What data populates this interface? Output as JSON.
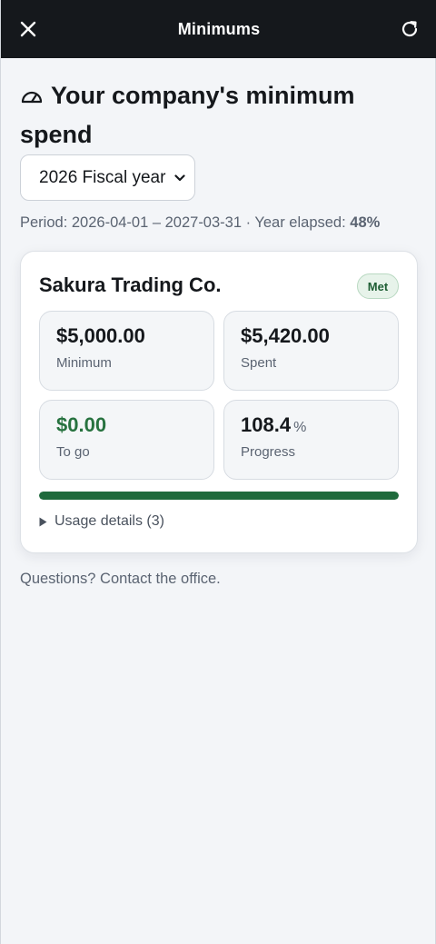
{
  "header": {
    "title": "Minimums",
    "close_icon": "close-icon",
    "refresh_icon": "refresh-icon"
  },
  "page": {
    "heading_icon": "gauge-icon",
    "heading": "Your company's minimum spend",
    "fiscal_select": {
      "selected": "2026 Fiscal year"
    },
    "period_prefix": "Period: 2026-04-01 – 2027-03-31 · Year elapsed: ",
    "year_elapsed": "48%"
  },
  "card": {
    "company": "Sakura Trading Co.",
    "status": "Met",
    "stats": {
      "minimum": {
        "value": "$5,000.00",
        "label": "Minimum"
      },
      "spent": {
        "value": "$5,420.00",
        "label": "Spent"
      },
      "to_go": {
        "value": "$0.00",
        "label": "To go"
      },
      "progress": {
        "value": "108.4",
        "unit": "%",
        "label": "Progress"
      }
    },
    "progress_fill_percent": 100,
    "usage_details": "Usage details (3)"
  },
  "footer": {
    "text": "Questions? Contact the office."
  },
  "colors": {
    "topbar": "#15181c",
    "accent_green": "#1f6a3c",
    "badge_bg": "#e7f3ea"
  }
}
